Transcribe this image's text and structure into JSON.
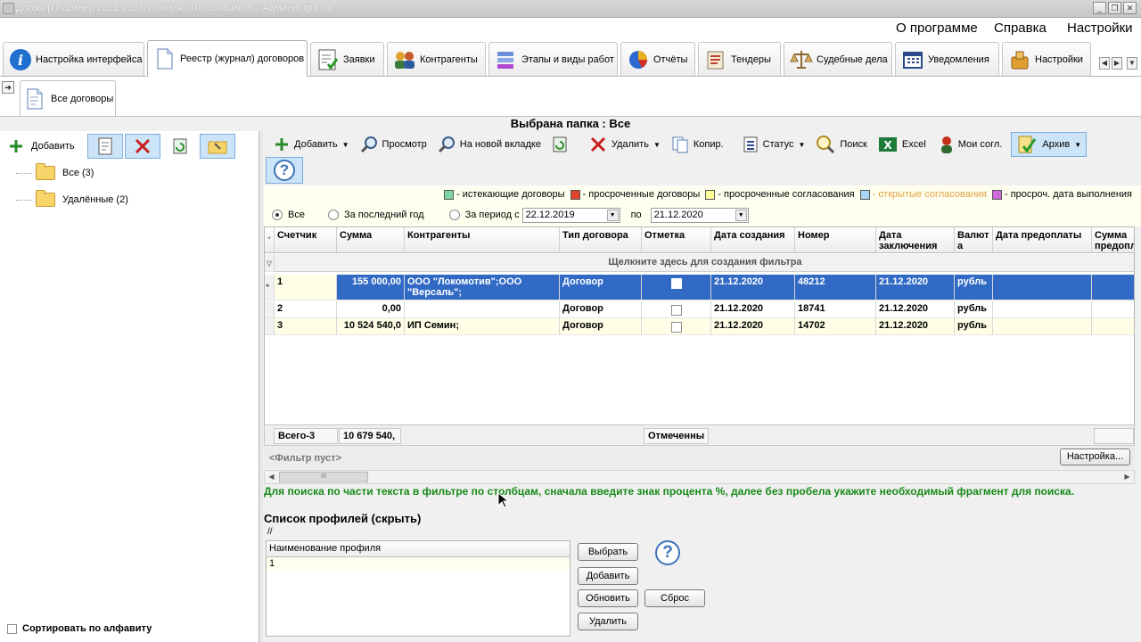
{
  "window": {
    "title": "Договор Партнер 2021 v10.5 Полная . Пользователь : Администратор"
  },
  "menu": {
    "about": "О программе",
    "help": "Справка",
    "settings": "Настройки"
  },
  "main_tabs": [
    {
      "label": "Настройка интерфейса",
      "icon": "info-icon"
    },
    {
      "label": "Реестр (журнал) договоров",
      "icon": "document-icon",
      "active": true
    },
    {
      "label": "Заявки",
      "icon": "checklist-icon"
    },
    {
      "label": "Контрагенты",
      "icon": "people-icon"
    },
    {
      "label": "Этапы и виды работ",
      "icon": "stages-icon"
    },
    {
      "label": "Отчёты",
      "icon": "pie-chart-icon"
    },
    {
      "label": "Тендеры",
      "icon": "tender-icon"
    },
    {
      "label": "Судебные дела",
      "icon": "scales-icon"
    },
    {
      "label": "Уведомления",
      "icon": "calendar-icon"
    },
    {
      "label": "Настройки",
      "icon": "settings-icon"
    }
  ],
  "sub_tab": {
    "label": "Все договоры"
  },
  "folder_bar": {
    "text": "Выбрана папка : Все"
  },
  "left_toolbar": {
    "add_label": "Добавить"
  },
  "tree": {
    "items": [
      {
        "label": "Все (3)"
      },
      {
        "label": "Удалённые (2)"
      }
    ]
  },
  "sort_alpha": {
    "label": "Сортировать по алфавиту",
    "checked": false
  },
  "toolbar": {
    "add": "Добавить",
    "view": "Просмотр",
    "new_tab": "На новой вкладке",
    "delete": "Удалить",
    "copy": "Копир.",
    "status": "Статус",
    "search": "Поиск",
    "excel": "Excel",
    "my_approvals": "Мои согл.",
    "archive": "Архив"
  },
  "legend": [
    {
      "label": "- истекающие договоры",
      "color": "#7fd6a3"
    },
    {
      "label": "- просроченные договоры",
      "color": "#e0452b"
    },
    {
      "label": "- просроченные согласования",
      "color": "#ffff9a"
    },
    {
      "label": "- открытые согласования",
      "color": "#a9d4f2"
    },
    {
      "label": "- просроч. дата выполнения",
      "color": "#d36adb"
    }
  ],
  "period_filter": {
    "all": "Все",
    "last_year": "За последний год",
    "period": "За период с",
    "date_from": "22.12.2019",
    "to": "по",
    "date_to": "21.12.2020"
  },
  "grid": {
    "columns": [
      "Счетчик",
      "Сумма",
      "Контрагенты",
      "Тип договора",
      "Отметка",
      "Дата создания",
      "Номер",
      "Дата заключения",
      "Валют а",
      "Дата предоплаты",
      "Сумма предопл"
    ],
    "filter_hint": "Щелкните здесь для создания фильтра",
    "rows": [
      {
        "counter": "1",
        "sum": "155 000,00",
        "counterparty": "ООО \"Локомотив\";ООО \"Версаль\";",
        "type": "Договор",
        "mark": true,
        "created": "21.12.2020",
        "number": "48212",
        "concluded": "21.12.2020",
        "currency": "рубль",
        "prepay_date": "",
        "prepay_sum": ""
      },
      {
        "counter": "2",
        "sum": "0,00",
        "counterparty": "",
        "type": "Договор",
        "mark": false,
        "created": "21.12.2020",
        "number": "18741",
        "concluded": "21.12.2020",
        "currency": "рубль",
        "prepay_date": "",
        "prepay_sum": ""
      },
      {
        "counter": "3",
        "sum": "10 524 540,0",
        "counterparty": "ИП Семин;",
        "type": "Договор",
        "mark": false,
        "created": "21.12.2020",
        "number": "14702",
        "concluded": "21.12.2020",
        "currency": "рубль",
        "prepay_date": "",
        "prepay_sum": ""
      }
    ],
    "totals": {
      "count": "Всего-3",
      "sum": "10 679 540,",
      "marked": "Отмеченны"
    }
  },
  "filter_state": {
    "text": "<Фильтр пуст>",
    "setup_button": "Настройка..."
  },
  "search_hint": "Для поиска по части текста в фильтре по столбцам, сначала введите знак процента %, далее без пробела укажите необходимый фрагмент для поиска.",
  "profiles": {
    "header": "Список профилей (скрыть)",
    "path": "//",
    "column": "Наименование профиля",
    "rows": [
      "1"
    ],
    "buttons": {
      "select": "Выбрать",
      "add": "Добавить",
      "refresh": "Обновить",
      "reset": "Сброс",
      "delete": "Удалить"
    }
  }
}
